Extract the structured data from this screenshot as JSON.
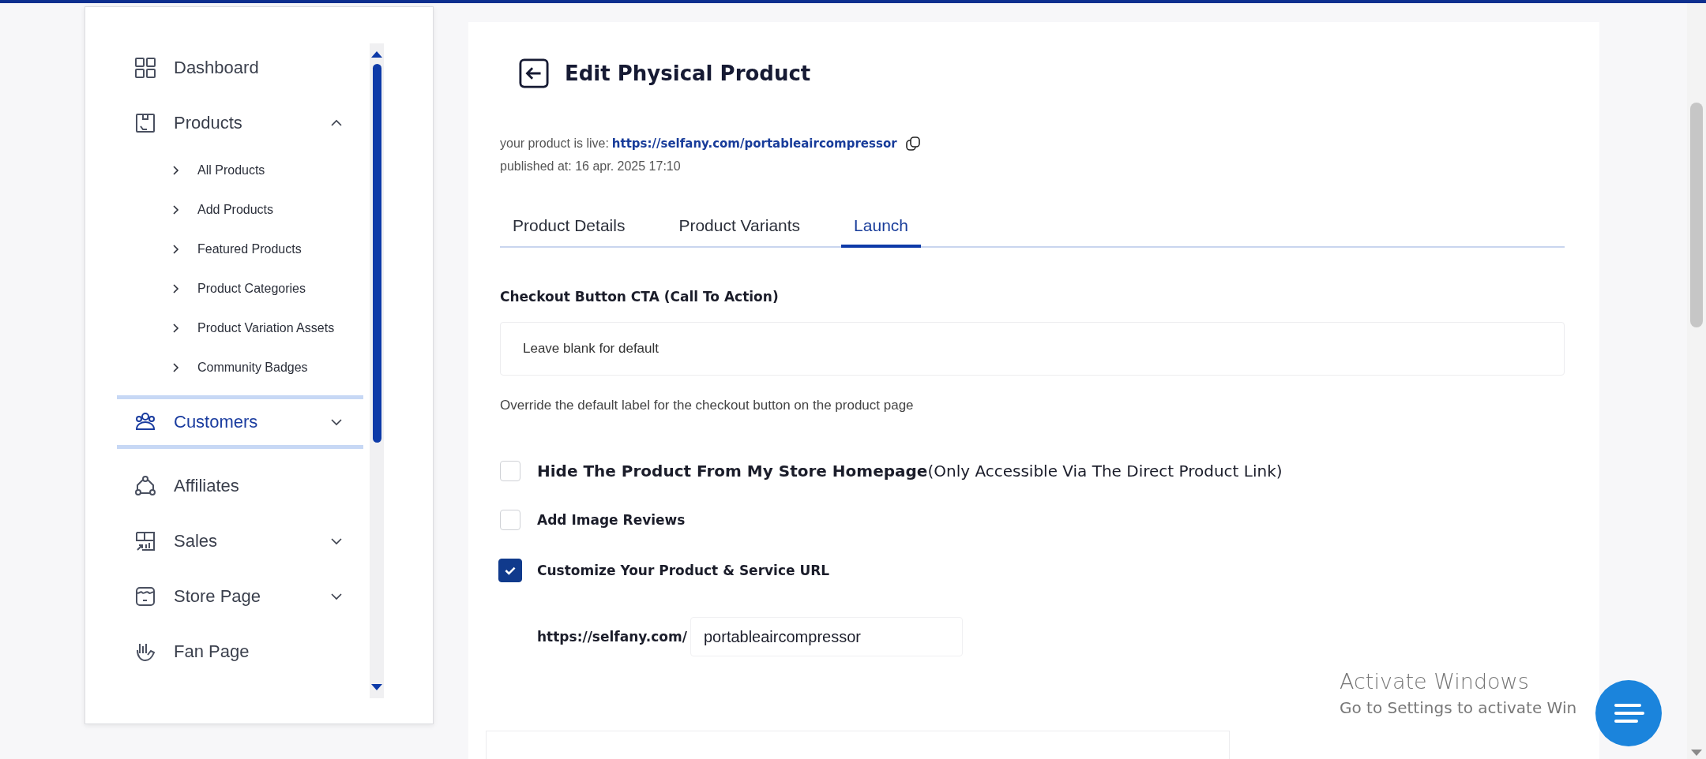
{
  "sidebar": {
    "items": [
      {
        "label": "Dashboard",
        "selected": false
      },
      {
        "label": "Products",
        "selected": false,
        "expanded": true,
        "children": [
          {
            "label": "All Products",
            "selected": false
          },
          {
            "label": "Add Products",
            "selected": false
          },
          {
            "label": "Featured Products",
            "selected": false
          },
          {
            "label": "Product Categories",
            "selected": false
          },
          {
            "label": "Product Variation Assets",
            "selected": false
          },
          {
            "label": "Community Badges",
            "selected": false
          }
        ]
      },
      {
        "label": "Customers",
        "selected": true,
        "expanded": false
      },
      {
        "label": "Affiliates",
        "selected": false
      },
      {
        "label": "Sales",
        "selected": false,
        "expanded": false
      },
      {
        "label": "Store Page",
        "selected": false,
        "expanded": false
      },
      {
        "label": "Fan Page",
        "selected": false
      }
    ]
  },
  "page": {
    "title": "Edit Physical Product",
    "live_label": "your product is live:",
    "live_url": "https://selfany.com/portableaircompressor",
    "published": "published at: 16 apr. 2025 17:10"
  },
  "tabs": [
    {
      "label": "Product Details",
      "selected": false
    },
    {
      "label": "Product Variants",
      "selected": false
    },
    {
      "label": "Launch",
      "selected": true
    }
  ],
  "cta": {
    "label": "Checkout Button CTA (Call To Action)",
    "placeholder": "Leave blank for default",
    "help": "Override the default label for the checkout button on the product page"
  },
  "options": [
    {
      "label": "Hide The Product From My Store Homepage",
      "note": "(Only Accessible Via The Direct Product Link)",
      "checked": false
    },
    {
      "label": "Add Image Reviews",
      "checked": false
    },
    {
      "label": "Customize Your Product & Service URL",
      "checked": true
    }
  ],
  "custom_url": {
    "prefix": "https://selfany.com/",
    "value": "portableaircompressor"
  },
  "os_notice": {
    "title": "Activate Windows",
    "subtitle": "Go to Settings to activate Win"
  }
}
